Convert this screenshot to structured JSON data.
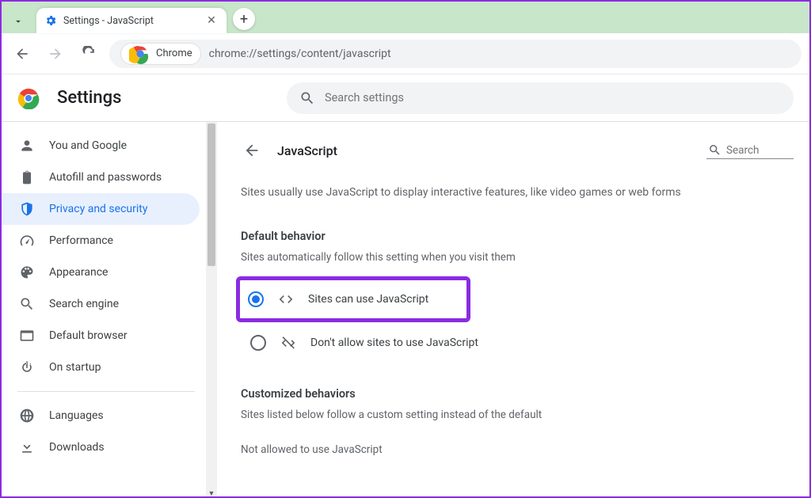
{
  "browser": {
    "tab_title": "Settings - JavaScript",
    "omnibox_chip": "Chrome",
    "url": "chrome://settings/content/javascript"
  },
  "header": {
    "app_title": "Settings",
    "search_placeholder": "Search settings"
  },
  "sidebar": {
    "items": [
      {
        "label": "You and Google"
      },
      {
        "label": "Autofill and passwords"
      },
      {
        "label": "Privacy and security"
      },
      {
        "label": "Performance"
      },
      {
        "label": "Appearance"
      },
      {
        "label": "Search engine"
      },
      {
        "label": "Default browser"
      },
      {
        "label": "On startup"
      }
    ],
    "extra": [
      {
        "label": "Languages"
      },
      {
        "label": "Downloads"
      }
    ]
  },
  "content": {
    "page_title": "JavaScript",
    "search_placeholder": "Search",
    "description": "Sites usually use JavaScript to display interactive features, like video games or web forms",
    "default_behavior_title": "Default behavior",
    "default_behavior_sub": "Sites automatically follow this setting when you visit them",
    "options": [
      {
        "label": "Sites can use JavaScript",
        "selected": true
      },
      {
        "label": "Don't allow sites to use JavaScript",
        "selected": false
      }
    ],
    "custom_title": "Customized behaviors",
    "custom_sub": "Sites listed below follow a custom setting instead of the default",
    "not_allowed_label": "Not allowed to use JavaScript"
  },
  "colors": {
    "accent": "#1a73e8",
    "highlight": "#8a2be2"
  }
}
